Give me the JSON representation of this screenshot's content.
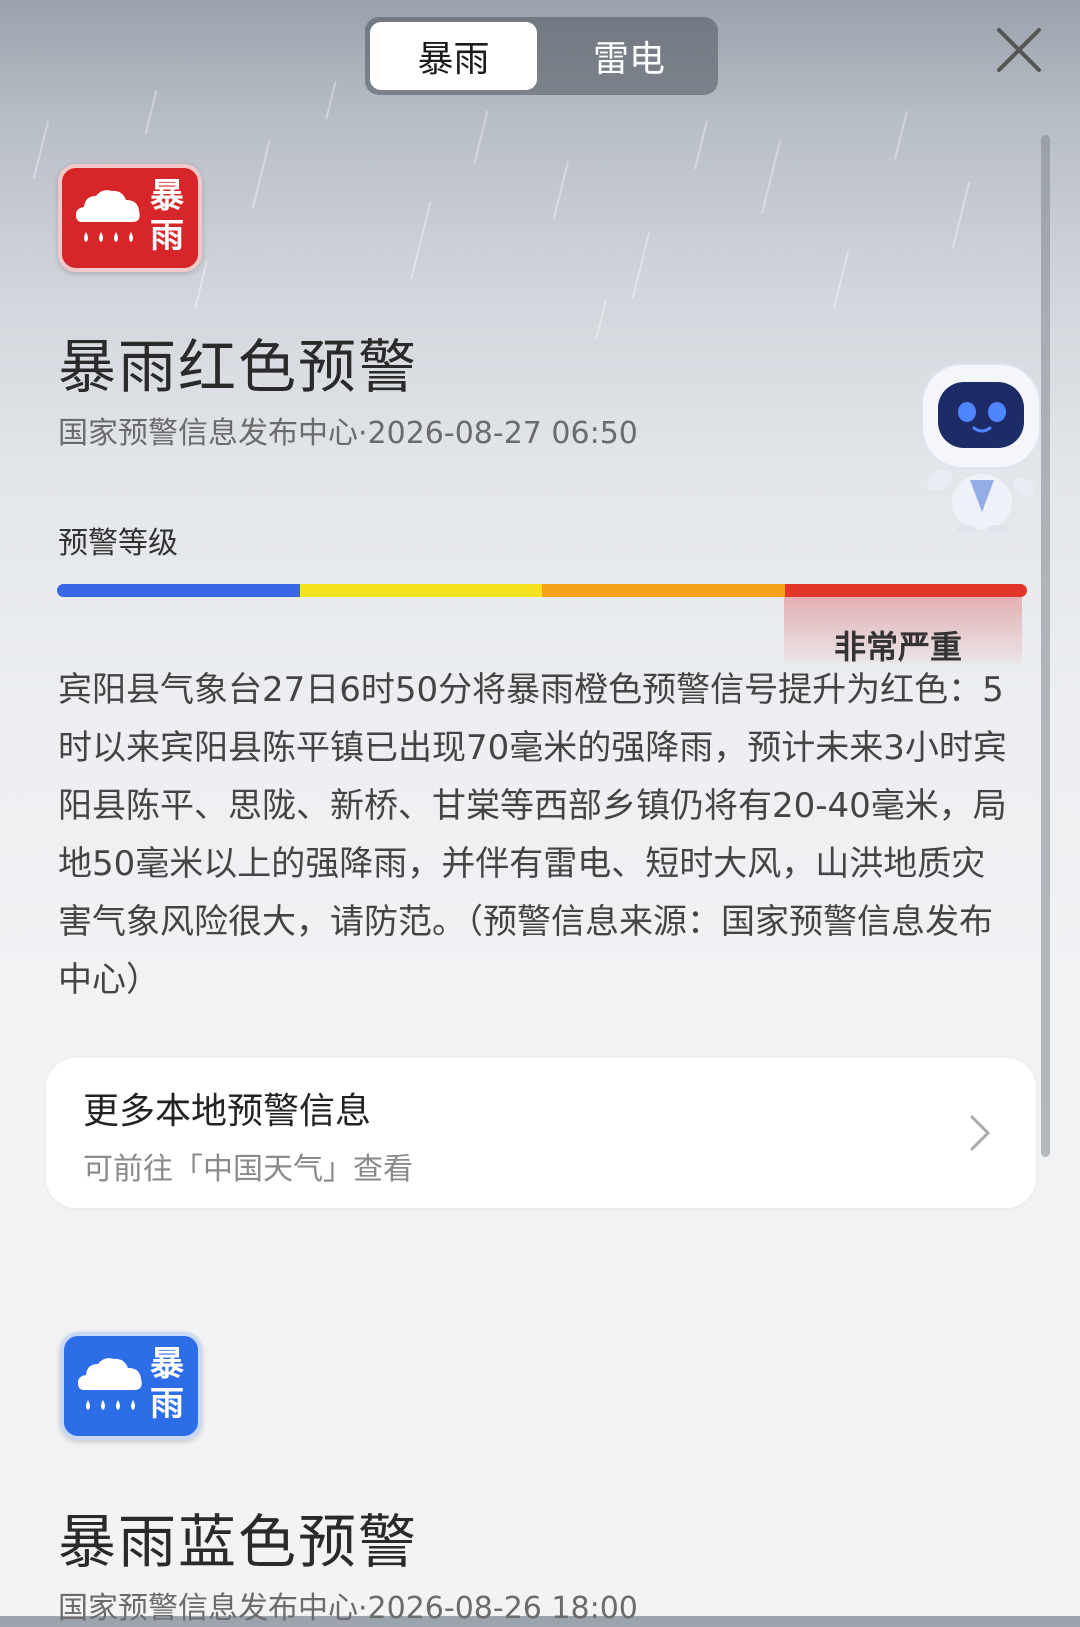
{
  "tabs": [
    {
      "label": "暴雨",
      "active": true
    },
    {
      "label": "雷电",
      "active": false
    }
  ],
  "close_icon": "close-icon",
  "warnings": [
    {
      "badge_text": "暴雨",
      "badge_color": "#d7262a",
      "title": "暴雨红色预警",
      "meta": "国家预警信息发布中心·2026-08-27 06:50",
      "level_label": "预警等级",
      "level_colors": [
        "#3a67e8",
        "#f5e21f",
        "#f5a21a",
        "#e2362b"
      ],
      "level_value": "非常严重",
      "description": "宾阳县气象台27日6时50分将暴雨橙色预警信号提升为红色：5时以来宾阳县陈平镇已出现70毫米的强降雨，预计未来3小时宾阳县陈平、思陇、新桥、甘棠等西部乡镇仍将有20-40毫米，局地50毫米以上的强降雨，并伴有雷电、短时大风，山洪地质灾害气象风险很大，请防范。（预警信息来源：国家预警信息发布中心）"
    },
    {
      "badge_text": "暴雨",
      "badge_color": "#2d6ee8",
      "title": "暴雨蓝色预警",
      "meta": "国家预警信息发布中心·2026-08-26 18:00"
    }
  ],
  "more_card": {
    "title": "更多本地预警信息",
    "subtitle": "可前往「中国天气」查看"
  }
}
